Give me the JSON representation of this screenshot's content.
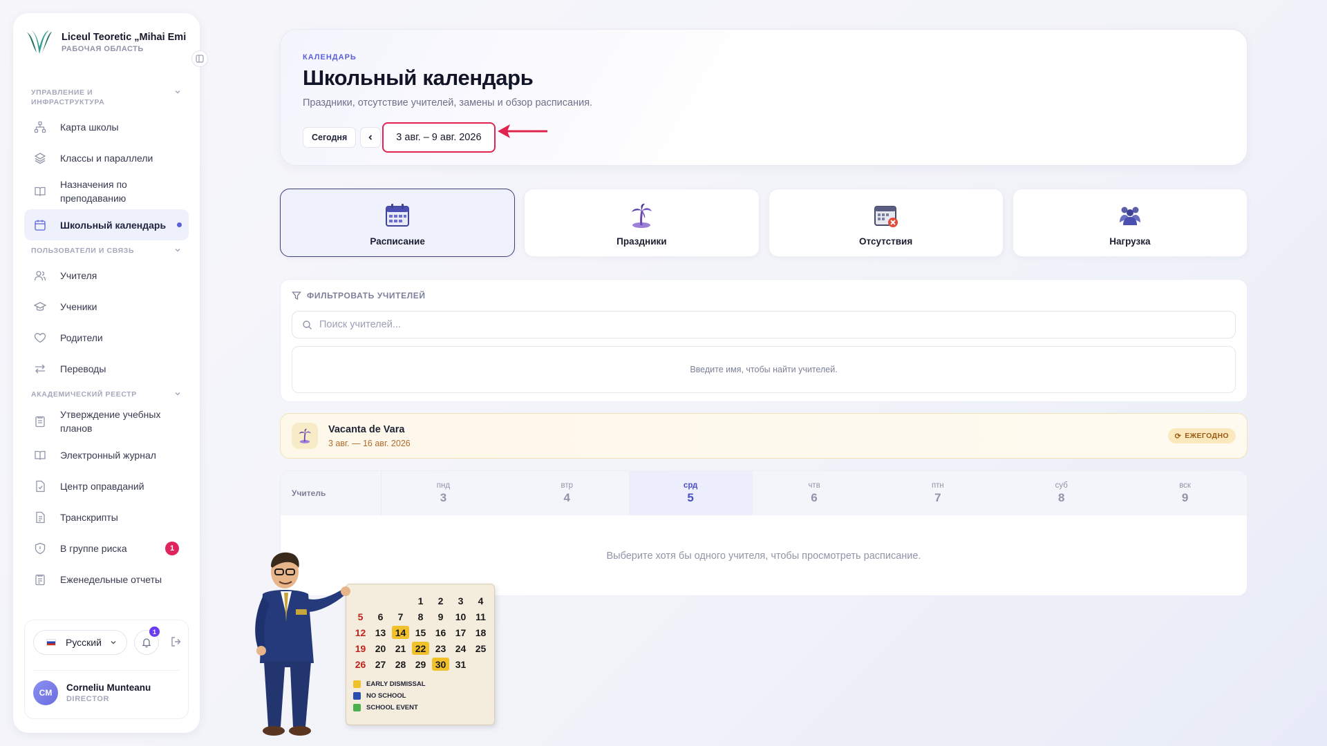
{
  "workspace": {
    "name": "Liceul Teoretic „Mihai Emi...",
    "subtitle": "РАБОЧАЯ ОБЛАСТЬ"
  },
  "sidebar": {
    "sections": [
      {
        "label": "УПРАВЛЕНИЕ И ИНФРАСТРУКТУРА",
        "items": [
          {
            "label": "Карта школы",
            "icon": "sitemap-icon"
          },
          {
            "label": "Классы и параллели",
            "icon": "layers-icon"
          },
          {
            "label": "Назначения по преподаванию",
            "icon": "book-open-icon"
          },
          {
            "label": "Школьный календарь",
            "icon": "calendar-icon",
            "active": true
          }
        ]
      },
      {
        "label": "ПОЛЬЗОВАТЕЛИ И СВЯЗЬ",
        "items": [
          {
            "label": "Учителя",
            "icon": "users-icon"
          },
          {
            "label": "Ученики",
            "icon": "graduation-cap-icon"
          },
          {
            "label": "Родители",
            "icon": "heart-icon"
          },
          {
            "label": "Переводы",
            "icon": "swap-arrows-icon"
          }
        ]
      },
      {
        "label": "АКАДЕМИЧЕСКИЙ РЕЕСТР",
        "items": [
          {
            "label": "Утверждение учебных планов",
            "icon": "clipboard-icon"
          },
          {
            "label": "Электронный журнал",
            "icon": "book-icon"
          },
          {
            "label": "Центр оправданий",
            "icon": "file-check-icon"
          },
          {
            "label": "Транскрипты",
            "icon": "file-text-icon"
          },
          {
            "label": "В группе риска",
            "icon": "shield-icon",
            "badge": "1"
          },
          {
            "label": "Еженедельные отчеты",
            "icon": "clipboard-list-icon"
          }
        ]
      }
    ],
    "language": "Русский",
    "notifications_count": "1",
    "user": {
      "initials": "CM",
      "name": "Corneliu Munteanu",
      "role": "DIRECTOR"
    }
  },
  "header": {
    "eyebrow": "КАЛЕНДАРЬ",
    "title": "Школьный календарь",
    "subtitle": "Праздники, отсутствие учителей, замены и обзор расписания.",
    "today_label": "Сегодня",
    "range": "3 авг. – 9 авг. 2026"
  },
  "tabs": [
    {
      "label": "Расписание",
      "icon": "calendar-grid-icon",
      "active": true
    },
    {
      "label": "Праздники",
      "icon": "palm-tree-icon"
    },
    {
      "label": "Отсутствия",
      "icon": "calendar-absence-icon"
    },
    {
      "label": "Нагрузка",
      "icon": "group-workload-icon"
    }
  ],
  "filter": {
    "title": "ФИЛЬТРОВАТЬ УЧИТЕЛЕЙ",
    "search_placeholder": "Поиск учителей...",
    "empty_text": "Введите имя, чтобы найти учителей."
  },
  "holiday": {
    "name": "Vacanta de Vara",
    "dates": "3 авг. — 16 авг. 2026",
    "badge": "ЕЖЕГОДНО"
  },
  "schedule": {
    "teacher_col": "Учитель",
    "days": [
      {
        "name": "пнд",
        "num": "3"
      },
      {
        "name": "втр",
        "num": "4"
      },
      {
        "name": "срд",
        "num": "5",
        "today": true
      },
      {
        "name": "чтв",
        "num": "6"
      },
      {
        "name": "птн",
        "num": "7"
      },
      {
        "name": "суб",
        "num": "8"
      },
      {
        "name": "вск",
        "num": "9"
      }
    ],
    "empty_text": "Выберите хотя бы одного учителя, чтобы просмотреть расписание."
  },
  "illustration": {
    "calendar_days": [
      [
        "",
        "",
        "",
        "1",
        "2",
        "3",
        "4"
      ],
      [
        "5",
        "6",
        "7",
        "8",
        "9",
        "10",
        "11"
      ],
      [
        "12",
        "13",
        "14",
        "15",
        "16",
        "17",
        "18"
      ],
      [
        "19",
        "20",
        "21",
        "22",
        "23",
        "24",
        "25"
      ],
      [
        "26",
        "27",
        "28",
        "29",
        "30",
        "31",
        ""
      ]
    ],
    "legend": [
      "EARLY DISMISSAL",
      "NO SCHOOL",
      "SCHOOL EVENT"
    ]
  },
  "colors": {
    "accent": "#5a5fd8",
    "highlight_border": "#e0244f",
    "risk_badge": "#e0245e"
  }
}
